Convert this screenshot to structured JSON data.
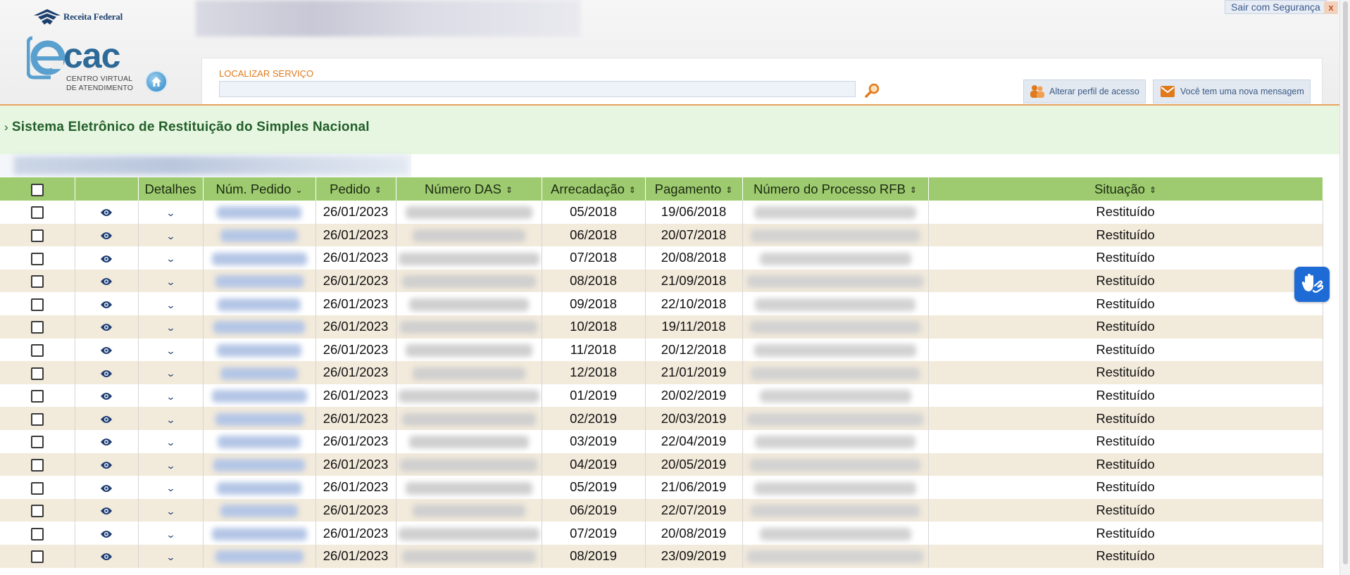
{
  "header": {
    "org_name": "Receita Federal",
    "app_logo_text": "cac",
    "app_logo_sub_line1": "CENTRO VIRTUAL",
    "app_logo_sub_line2": "DE ATENDIMENTO",
    "logout_label": "Sair com Segurança",
    "close_label": "x"
  },
  "search": {
    "label": "LOCALIZAR SERVIÇO",
    "value": "",
    "placeholder": ""
  },
  "actions": {
    "profile_label": "Alterar perfil de acesso",
    "message_label": "Você tem uma nova mensagem"
  },
  "system": {
    "title": "Sistema Eletrônico de Restituição do Simples Nacional"
  },
  "table": {
    "columns": {
      "detalhes": "Detalhes",
      "num_pedido": "Núm. Pedido",
      "pedido": "Pedido",
      "numero_das": "Número DAS",
      "arrecadacao": "Arrecadação",
      "pagamento": "Pagamento",
      "numero_processo": "Número do Processo RFB",
      "situacao": "Situação"
    },
    "rows": [
      {
        "pedido": "26/01/2023",
        "arrecadacao": "05/2018",
        "pagamento": "19/06/2018",
        "situacao": "Restituído"
      },
      {
        "pedido": "26/01/2023",
        "arrecadacao": "06/2018",
        "pagamento": "20/07/2018",
        "situacao": "Restituído"
      },
      {
        "pedido": "26/01/2023",
        "arrecadacao": "07/2018",
        "pagamento": "20/08/2018",
        "situacao": "Restituído"
      },
      {
        "pedido": "26/01/2023",
        "arrecadacao": "08/2018",
        "pagamento": "21/09/2018",
        "situacao": "Restituído"
      },
      {
        "pedido": "26/01/2023",
        "arrecadacao": "09/2018",
        "pagamento": "22/10/2018",
        "situacao": "Restituído"
      },
      {
        "pedido": "26/01/2023",
        "arrecadacao": "10/2018",
        "pagamento": "19/11/2018",
        "situacao": "Restituído"
      },
      {
        "pedido": "26/01/2023",
        "arrecadacao": "11/2018",
        "pagamento": "20/12/2018",
        "situacao": "Restituído"
      },
      {
        "pedido": "26/01/2023",
        "arrecadacao": "12/2018",
        "pagamento": "21/01/2019",
        "situacao": "Restituído"
      },
      {
        "pedido": "26/01/2023",
        "arrecadacao": "01/2019",
        "pagamento": "20/02/2019",
        "situacao": "Restituído"
      },
      {
        "pedido": "26/01/2023",
        "arrecadacao": "02/2019",
        "pagamento": "20/03/2019",
        "situacao": "Restituído"
      },
      {
        "pedido": "26/01/2023",
        "arrecadacao": "03/2019",
        "pagamento": "22/04/2019",
        "situacao": "Restituído"
      },
      {
        "pedido": "26/01/2023",
        "arrecadacao": "04/2019",
        "pagamento": "20/05/2019",
        "situacao": "Restituído"
      },
      {
        "pedido": "26/01/2023",
        "arrecadacao": "05/2019",
        "pagamento": "21/06/2019",
        "situacao": "Restituído"
      },
      {
        "pedido": "26/01/2023",
        "arrecadacao": "06/2019",
        "pagamento": "22/07/2019",
        "situacao": "Restituído"
      },
      {
        "pedido": "26/01/2023",
        "arrecadacao": "07/2019",
        "pagamento": "20/08/2019",
        "situacao": "Restituído"
      },
      {
        "pedido": "26/01/2023",
        "arrecadacao": "08/2019",
        "pagamento": "23/09/2019",
        "situacao": "Restituído"
      }
    ]
  },
  "icons": {
    "home": "home-icon",
    "search": "magnifier-icon",
    "profile": "users-icon",
    "message": "envelope-icon",
    "view": "eye-icon",
    "details": "chevron-down-icon",
    "sort": "sort-icon",
    "accessibility": "sign-language-icon"
  },
  "colors": {
    "header_accent": "#e07a1c",
    "title_green": "#235f2a",
    "table_header": "#9ecb6f",
    "row_alt": "#f2eadb",
    "link_blue": "#3c5a84",
    "vlibras_blue": "#1e6bd6"
  }
}
